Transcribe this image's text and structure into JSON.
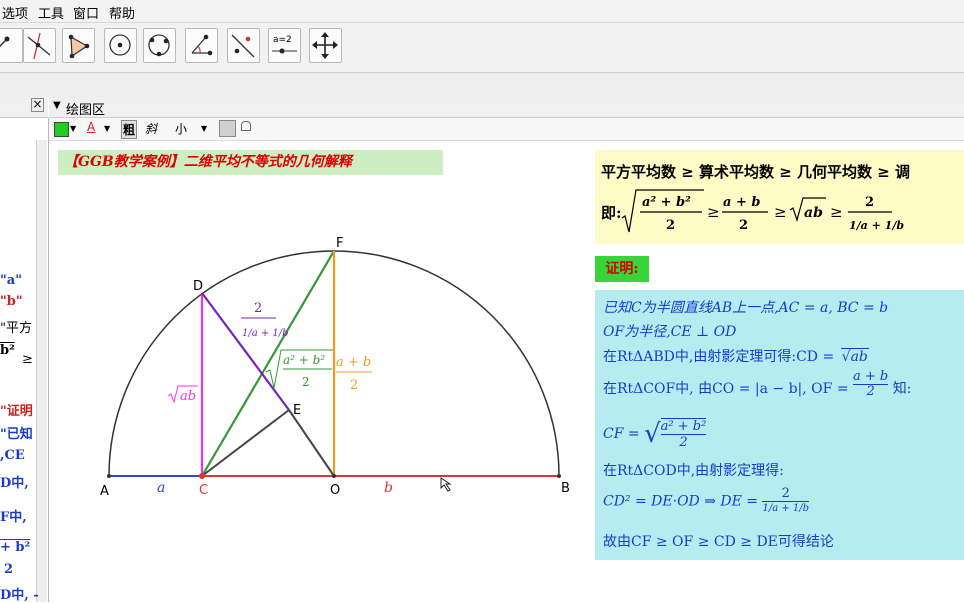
{
  "menu": {
    "items": [
      "选项",
      "工具",
      "窗口",
      "帮助"
    ]
  },
  "toolbar": {
    "tools": [
      "move-graphic-icon",
      "line-icon",
      "perpendicular-icon",
      "polygon-icon",
      "circle-icon",
      "circle-3pts-icon",
      "angle-icon",
      "reflect-icon",
      "slider-icon",
      "move-view-icon"
    ],
    "slider_label": "a=2"
  },
  "graphics_panel": {
    "title": "绘图区",
    "style_bold": "粗",
    "style_italic": "斜",
    "style_size": "小",
    "text_color_label": "A",
    "accent_green": "#22cc22"
  },
  "algebra_panel": {
    "lines": [
      "\"a\"",
      "\"b\"",
      "\"平方",
      "b²",
      "\"证明",
      "\"已知",
      ",CE",
      "D中,",
      "F中,",
      "+ b²",
      "2",
      "D中, -"
    ]
  },
  "title_box": {
    "text": "【GGB教学案例】二维平均不等式的几何解释",
    "bg": "#cdeec3",
    "color": "#e00000"
  },
  "theorem_box": {
    "line1": "平方平均数 ≥ 算术平均数 ≥ 几何平均数 ≥ 调",
    "prefix": "即:",
    "rms_num": "a² + b²",
    "den_2": "2",
    "am_num": "a + b",
    "gm": "ab",
    "hm_num": "2",
    "hm_den": "1/a + 1/b",
    "geq": "≥",
    "bg": "#fffbc6"
  },
  "proof_badge": {
    "text": "证明:",
    "bg": "#38d43a"
  },
  "proof_box": {
    "bg": "#b6ecf0",
    "line1": "已知C为半圆直线AB上一点,AC = a, BC = b",
    "line2": "OF为半径,CE ⊥ OD",
    "line3_prefix": "在RtΔABD中,由射影定理可得:CD = ",
    "line3_root": "ab",
    "line4_prefix": "在RtΔCOF中,  由CO = |a − b|, OF = ",
    "line4_num": "a + b",
    "line4_den": "2",
    "line4_suffix": "知:",
    "line5_prefix": "CF = ",
    "line5_num": "a² + b²",
    "line5_den": "2",
    "line6": "在RtΔCOD中,由射影定理得:",
    "line7_prefix": "CD² = DE·OD ⇒ DE = ",
    "line7_num": "2",
    "line7_den": "1/a + 1/b",
    "line8": "故由CF ≥ OF ≥ CD ≥ DE可得结论"
  },
  "figure": {
    "points": [
      "A",
      "C",
      "O",
      "B",
      "D",
      "E",
      "F"
    ],
    "seg_label_a": "a",
    "seg_label_b": "b",
    "label_gm": "ab",
    "label_hm_num": "2",
    "label_hm_den": "1/a + 1/b",
    "label_rms_num": "a² + b²",
    "label_rms_den": "2",
    "label_am_num": "a + b",
    "label_am_den": "2",
    "colors": {
      "circle": "#333333",
      "AC": "#3344cc",
      "CB": "#dd3333",
      "CD": "#ee33ee",
      "CF": "#339933",
      "OF": "#ee9922",
      "BD": "#7722bb",
      "CE": "#444444",
      "OD": "#444444"
    }
  }
}
